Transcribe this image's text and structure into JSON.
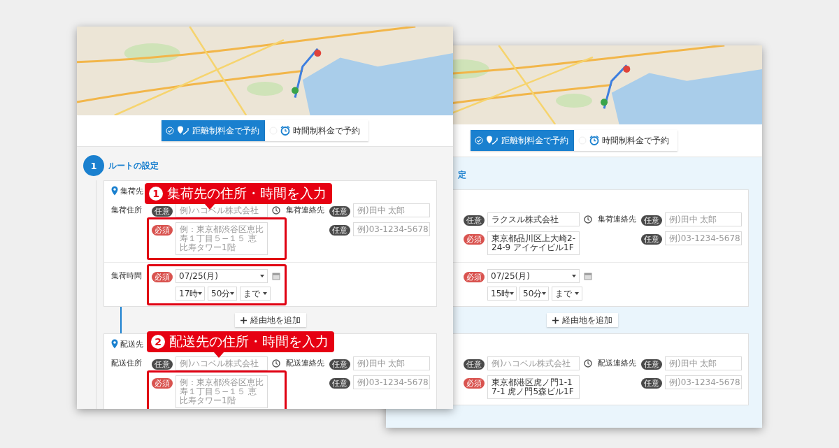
{
  "front_window": {
    "tabs": [
      {
        "label": "距離制料金で予約",
        "kind": "distance",
        "selected": true
      },
      {
        "label": "時間制料金で予約",
        "kind": "time",
        "selected": false
      }
    ],
    "step": {
      "number": "1",
      "title": "ルートの設定"
    },
    "stops": [
      {
        "heading": "集荷先",
        "address_label": "集荷住所",
        "name_field": {
          "badge": "任意",
          "required": false,
          "placeholder": "例)ハコベル株式会社"
        },
        "address_field": {
          "badge": "必須",
          "required": true,
          "placeholder": "例：東京都渋谷区恵比寿１丁目５−１５ 恵比寿タワー1階",
          "highlighted": true
        },
        "contact_label": "集荷連絡先",
        "contact_field": {
          "badge": "任意",
          "required": false,
          "placeholder": "例)田中 太郎"
        },
        "phone_field": {
          "badge": "任意",
          "required": false,
          "placeholder": "例)03-1234-5678"
        },
        "time": {
          "label": "集荷時間",
          "badge": "必須",
          "required": true,
          "date": "07/25(月)",
          "hour": "17時",
          "minute": "50分",
          "until": "まで",
          "highlighted": true
        }
      },
      {
        "heading": "配送先",
        "address_label": "配送住所",
        "name_field": {
          "badge": "任意",
          "required": false,
          "placeholder": "例)ハコベル株式会社"
        },
        "address_field": {
          "badge": "必須",
          "required": true,
          "placeholder": "例：東京都渋谷区恵比寿１丁目５−１５ 恵比寿タワー1階",
          "highlighted": true
        },
        "contact_label": "配送連絡先",
        "contact_field": {
          "badge": "任意",
          "required": false,
          "placeholder": "例)田中 太郎"
        },
        "phone_field": {
          "badge": "任意",
          "required": false,
          "placeholder": "例)03-1234-5678"
        }
      }
    ],
    "add_waypoint_button": "経由地を追加",
    "callouts": [
      {
        "number": "1",
        "text": "集荷先の住所・時間を入力"
      },
      {
        "number": "2",
        "text": "配送先の住所・時間を入力"
      }
    ]
  },
  "back_window": {
    "tabs": [
      {
        "label": "距離制料金で予約",
        "kind": "distance",
        "selected": true
      },
      {
        "label": "時間制料金で予約",
        "kind": "time",
        "selected": false
      }
    ],
    "step": {
      "title": "定"
    },
    "stops": [
      {
        "name_field": {
          "badge": "任意",
          "required": false,
          "value": "ラクスル株式会社"
        },
        "address_field": {
          "badge": "必須",
          "required": true,
          "value": "東京都品川区上大崎2-24-9 アイケイビル1F",
          "highlighted": false
        },
        "contact_label": "集荷連絡先",
        "contact_field": {
          "badge": "任意",
          "required": false,
          "placeholder": "例)田中 太郎"
        },
        "phone_field": {
          "badge": "任意",
          "required": false,
          "placeholder": "例)03-1234-5678"
        },
        "time": {
          "badge": "必須",
          "required": true,
          "date": "07/25(月)",
          "hour": "15時",
          "minute": "50分",
          "until": "まで",
          "highlighted": false
        }
      },
      {
        "name_field": {
          "badge": "任意",
          "required": false,
          "placeholder": "例)ハコベル株式会社"
        },
        "address_field": {
          "badge": "必須",
          "required": true,
          "value": "東京都港区虎ノ門1-17-1 虎ノ門5森ビル1F",
          "highlighted": false
        },
        "contact_label": "配送連絡先",
        "contact_field": {
          "badge": "任意",
          "required": false,
          "placeholder": "例)田中 太郎"
        },
        "phone_field": {
          "badge": "任意",
          "required": false,
          "placeholder": "例)03-1234-5678"
        }
      }
    ],
    "add_waypoint_button": "経由地を追加"
  }
}
